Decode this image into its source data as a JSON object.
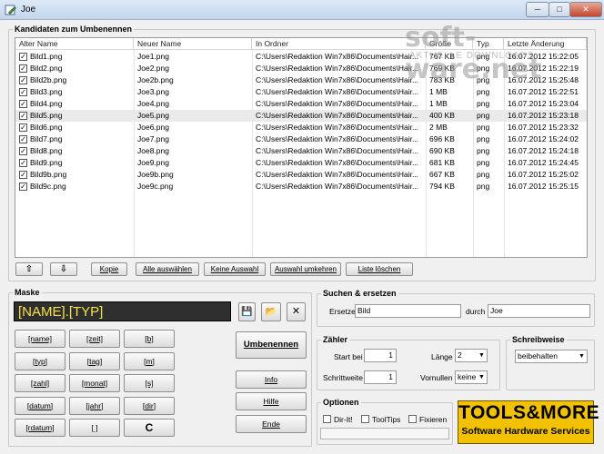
{
  "window": {
    "title": "Joe",
    "min": "─",
    "max": "□",
    "close": "✕"
  },
  "watermark": {
    "brand": "soft-ware.net",
    "tagline": "AKTUELLE DOWNLOADS"
  },
  "candidates": {
    "label": "Kandidaten zum Umbenennen",
    "columns": [
      "Alter Name",
      "Neuer Name",
      "In Ordner",
      "Größe",
      "Typ",
      "Letzte Änderung"
    ],
    "rows": [
      {
        "old": "Bild1.png",
        "new": "Joe1.png",
        "folder": "C:\\Users\\Redaktion Win7x86\\Documents\\Hair...",
        "size": "767 KB",
        "type": "png",
        "date": "16.07.2012 15:22:05"
      },
      {
        "old": "Bild2.png",
        "new": "Joe2.png",
        "folder": "C:\\Users\\Redaktion Win7x86\\Documents\\Hair...",
        "size": "769 KB",
        "type": "png",
        "date": "16.07.2012 15:22:19"
      },
      {
        "old": "Bild2b.png",
        "new": "Joe2b.png",
        "folder": "C:\\Users\\Redaktion Win7x86\\Documents\\Hair...",
        "size": "783 KB",
        "type": "png",
        "date": "16.07.2012 15:25:48"
      },
      {
        "old": "Bild3.png",
        "new": "Joe3.png",
        "folder": "C:\\Users\\Redaktion Win7x86\\Documents\\Hair...",
        "size": "1 MB",
        "type": "png",
        "date": "16.07.2012 15:22:51"
      },
      {
        "old": "Bild4.png",
        "new": "Joe4.png",
        "folder": "C:\\Users\\Redaktion Win7x86\\Documents\\Hair...",
        "size": "1 MB",
        "type": "png",
        "date": "16.07.2012 15:23:04"
      },
      {
        "old": "Bild5.png",
        "new": "Joe5.png",
        "folder": "C:\\Users\\Redaktion Win7x86\\Documents\\Hair...",
        "size": "400 KB",
        "type": "png",
        "date": "16.07.2012 15:23:18"
      },
      {
        "old": "Bild6.png",
        "new": "Joe6.png",
        "folder": "C:\\Users\\Redaktion Win7x86\\Documents\\Hair...",
        "size": "2 MB",
        "type": "png",
        "date": "16.07.2012 15:23:32"
      },
      {
        "old": "Bild7.png",
        "new": "Joe7.png",
        "folder": "C:\\Users\\Redaktion Win7x86\\Documents\\Hair...",
        "size": "696 KB",
        "type": "png",
        "date": "16.07.2012 15:24:02"
      },
      {
        "old": "Bild8.png",
        "new": "Joe8.png",
        "folder": "C:\\Users\\Redaktion Win7x86\\Documents\\Hair...",
        "size": "690 KB",
        "type": "png",
        "date": "16.07.2012 15:24:18"
      },
      {
        "old": "Bild9.png",
        "new": "Joe9.png",
        "folder": "C:\\Users\\Redaktion Win7x86\\Documents\\Hair...",
        "size": "681 KB",
        "type": "png",
        "date": "16.07.2012 15:24:45"
      },
      {
        "old": "Bild9b.png",
        "new": "Joe9b.png",
        "folder": "C:\\Users\\Redaktion Win7x86\\Documents\\Hair...",
        "size": "667 KB",
        "type": "png",
        "date": "16.07.2012 15:25:02"
      },
      {
        "old": "Bild9c.png",
        "new": "Joe9c.png",
        "folder": "C:\\Users\\Redaktion Win7x86\\Documents\\Hair...",
        "size": "794 KB",
        "type": "png",
        "date": "16.07.2012 15:25:15"
      }
    ],
    "selected_row": 5,
    "checkmark": "✓"
  },
  "listbar": {
    "up": "⇧",
    "down": "⇩",
    "copy": "Kopie",
    "select_all": "Alle auswählen",
    "select_none": "Keine Auswahl",
    "invert": "Auswahl umkehren",
    "clear": "Liste löschen"
  },
  "mask": {
    "label": "Maske",
    "value": "[NAME].[TYP]",
    "tokens": [
      "[name]",
      "[zeit]",
      "[b]",
      "[typ]",
      "[tag]",
      "[m]",
      "[zahl]",
      "[monat]",
      "[s]",
      "[datum]",
      "[jahr]",
      "[dir]",
      "[rdatum]",
      "[ ]",
      "C"
    ],
    "save_icon": "💾",
    "open_icon": "📂",
    "clear_icon": "✕",
    "rename": "Umbenennen",
    "info": "Info",
    "help": "Hilfe",
    "end": "Ende"
  },
  "search": {
    "label": "Suchen & ersetzen",
    "replace_label": "Ersetze",
    "replace_value": "Bild",
    "with_label": "durch",
    "with_value": "Joe"
  },
  "counter": {
    "label": "Zähler",
    "start_label": "Start bei",
    "start_value": "1",
    "step_label": "Schrittweite",
    "step_value": "1",
    "length_label": "Länge",
    "length_value": "2",
    "zeros_label": "Vornullen",
    "zeros_value": "keine"
  },
  "case": {
    "label": "Schreibweise",
    "value": "beibehalten"
  },
  "options": {
    "label": "Optionen",
    "dirit": "Dir-It!",
    "tooltips": "ToolTips",
    "fixed": "Fixieren"
  },
  "logo": {
    "line1": "TOOLS&MORE",
    "line2": "Software Hardware Services"
  },
  "colors": {
    "mask_bg": "#2f2f2f",
    "mask_text": "#f7e14a",
    "logo_bg": "#f2c200"
  }
}
